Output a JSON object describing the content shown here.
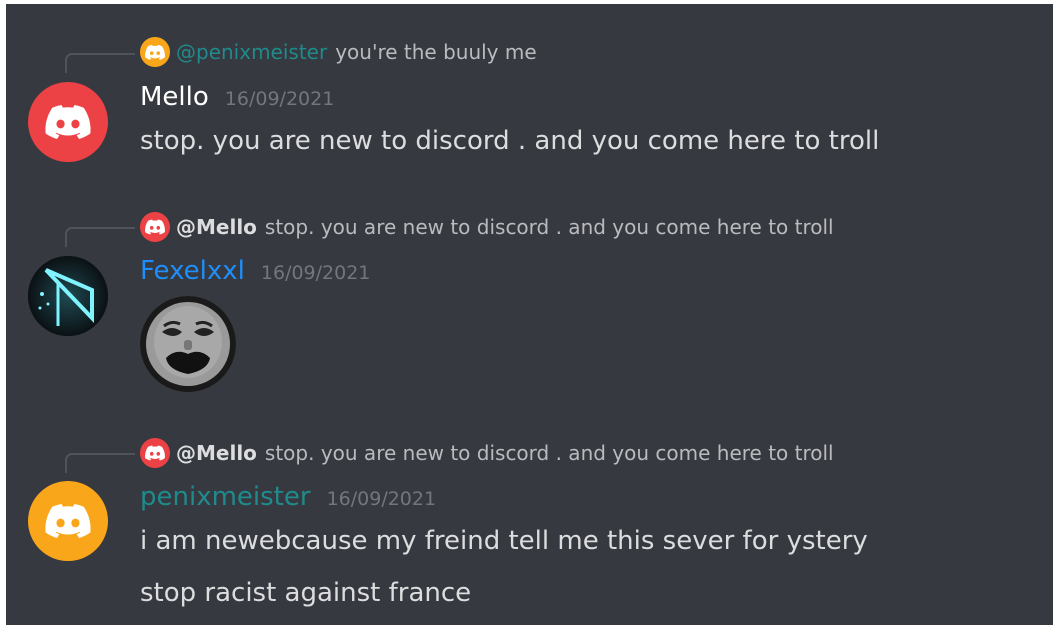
{
  "colors": {
    "background": "#36393f",
    "red_avatar": "#ed4245",
    "yellow_avatar": "#faa61a",
    "teal_name": "#1f8b8c",
    "blue_name": "#1f8efa",
    "white_name": "#ffffff",
    "text": "#dcddde",
    "muted": "#72767d"
  },
  "messages": [
    {
      "reply": {
        "avatar_icon": "discord-logo-icon",
        "author": "@penixmeister",
        "text": "you're the buuly me"
      },
      "author": "Mello",
      "timestamp": "16/09/2021",
      "avatar_icon": "discord-logo-icon",
      "lines": [
        "stop. you are new to discord . and you come here to troll"
      ]
    },
    {
      "reply": {
        "avatar_icon": "discord-logo-icon",
        "author": "@Mello",
        "text": "stop. you are new to discord . and you come here to troll"
      },
      "author": "Fexelxxl",
      "timestamp": "16/09/2021",
      "avatar_icon": "custom-avatar-icon",
      "attachment_icon": "meme-face-emoji-icon",
      "lines": []
    },
    {
      "reply": {
        "avatar_icon": "discord-logo-icon",
        "author": "@Mello",
        "text": "stop. you are new to discord . and you come here to troll"
      },
      "author": "penixmeister",
      "timestamp": "16/09/2021",
      "avatar_icon": "discord-logo-icon",
      "lines": [
        "i am newebcause my freind tell me this sever for ystery",
        "stop racist against france"
      ]
    }
  ]
}
